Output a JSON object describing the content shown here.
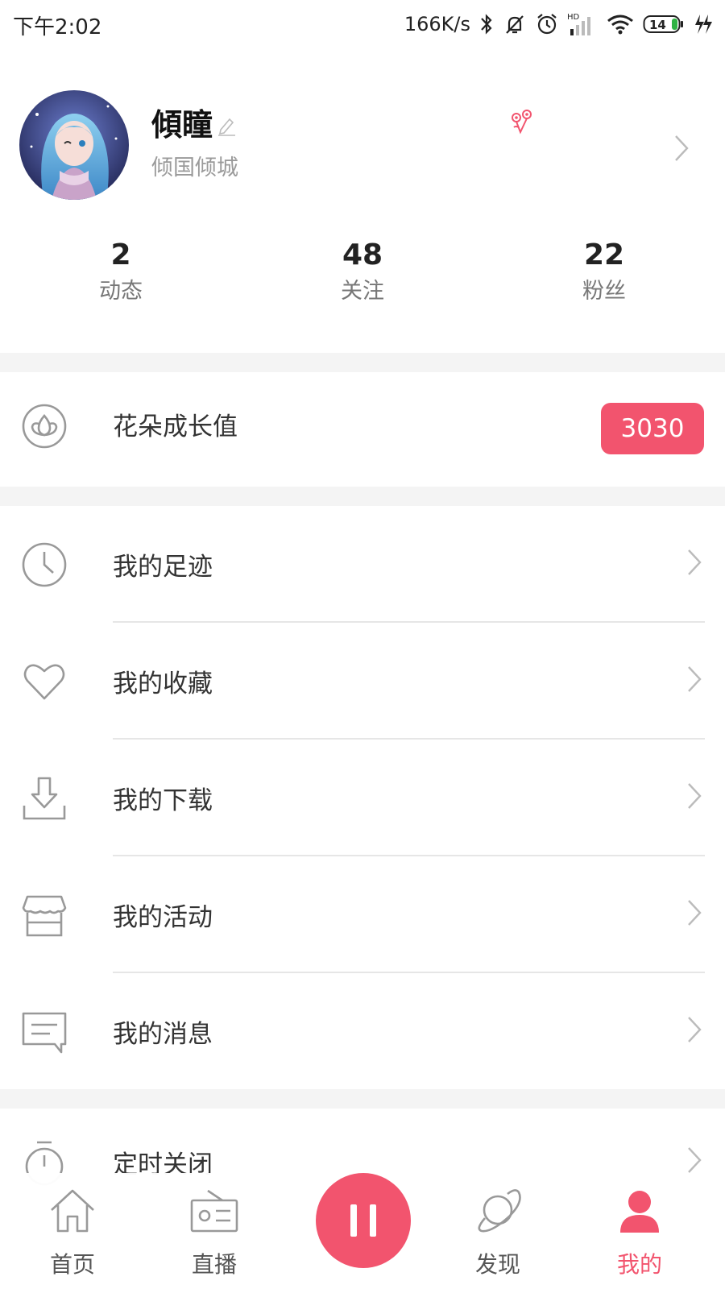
{
  "status_bar": {
    "time": "下午2:02",
    "net_speed": "166K/s",
    "hd_label": "HD",
    "battery": "14",
    "icons": [
      "bluetooth-icon",
      "mute-bell-icon",
      "alarm-icon",
      "signal-icon",
      "wifi-icon",
      "battery-icon",
      "charging-icon"
    ]
  },
  "profile": {
    "username": "傾瞳",
    "signature": "倾国倾城",
    "stats": [
      {
        "value": "2",
        "label": "动态"
      },
      {
        "value": "48",
        "label": "关注"
      },
      {
        "value": "22",
        "label": "粉丝"
      }
    ]
  },
  "growth": {
    "label": "花朵成长值",
    "value": "3030"
  },
  "menu": [
    {
      "label": "我的足迹",
      "icon": "clock-icon"
    },
    {
      "label": "我的收藏",
      "icon": "heart-icon"
    },
    {
      "label": "我的下载",
      "icon": "download-icon"
    },
    {
      "label": "我的活动",
      "icon": "store-icon"
    },
    {
      "label": "我的消息",
      "icon": "message-icon"
    },
    {
      "label": "定时关闭",
      "icon": "timer-icon"
    }
  ],
  "bottom_nav": [
    {
      "label": "首页",
      "icon": "home-icon",
      "active": false
    },
    {
      "label": "直播",
      "icon": "radio-icon",
      "active": false
    },
    {
      "label": "",
      "icon": "pause-icon",
      "active": false
    },
    {
      "label": "发现",
      "icon": "planet-icon",
      "active": false
    },
    {
      "label": "我的",
      "icon": "user-icon",
      "active": true
    }
  ],
  "colors": {
    "accent": "#f2546e",
    "icon_gray": "#999999",
    "divider": "#e6e6e6",
    "section_gap": "#f4f4f4"
  }
}
